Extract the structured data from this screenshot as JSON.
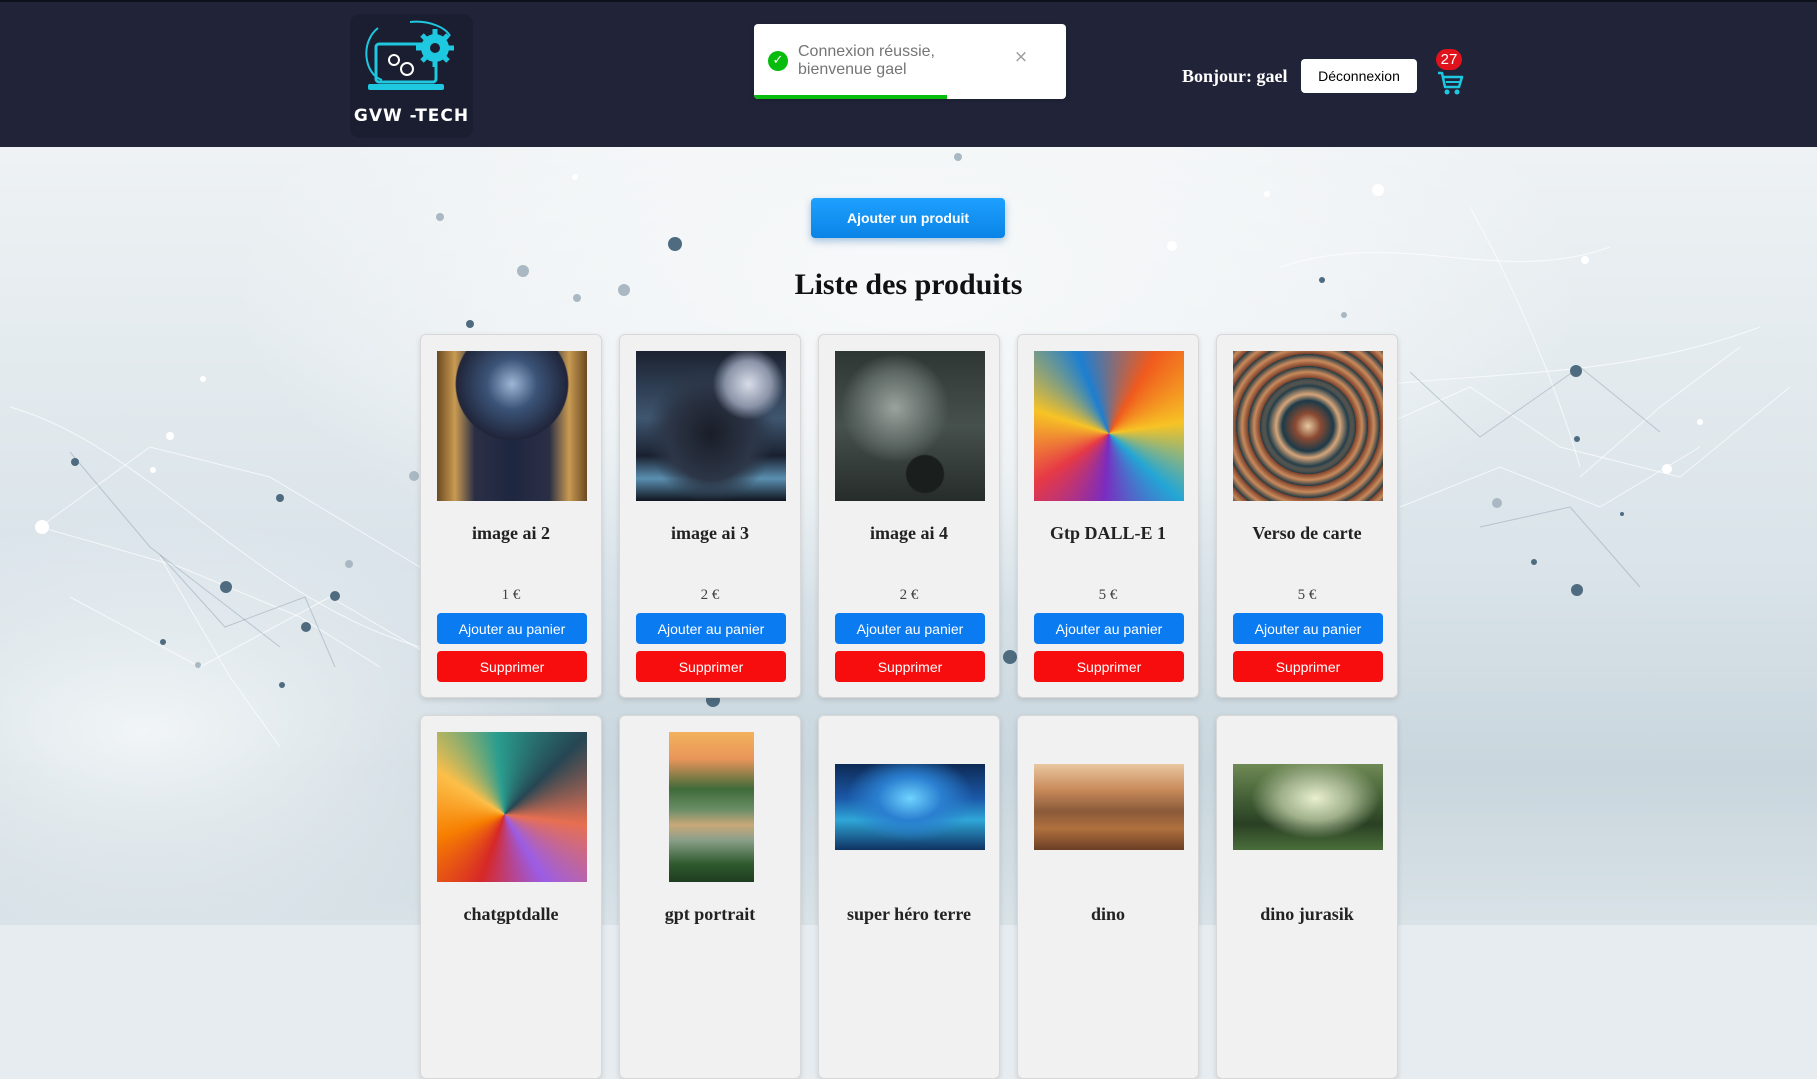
{
  "header": {
    "logo_text": "GVW -TECH",
    "greeting": "Bonjour: gael",
    "logout_label": "Déconnexion",
    "cart_count": "27"
  },
  "toast": {
    "message": "Connexion réussie, bienvenue gael",
    "close": "×",
    "progress_fraction": 0.62
  },
  "main": {
    "add_product_label": "Ajouter un produit",
    "title": "Liste des produits",
    "add_to_cart_label": "Ajouter au panier",
    "delete_label": "Supprimer"
  },
  "products": [
    {
      "name": "image ai 2",
      "price": "1 €",
      "image": "mystical-cathedral"
    },
    {
      "name": "image ai 3",
      "price": "2 €",
      "image": "dark-forest-moon"
    },
    {
      "name": "image ai 4",
      "price": "2 €",
      "image": "moonlit-chapel"
    },
    {
      "name": "Gtp DALL-E 1",
      "price": "5 €",
      "image": "colorful-swirl"
    },
    {
      "name": "Verso de carte",
      "price": "5 €",
      "image": "ornate-pattern"
    },
    {
      "name": "chatgptdalle",
      "price": "",
      "image": "abstract-swirl"
    },
    {
      "name": "gpt portrait",
      "price": "",
      "image": "lake-landscape"
    },
    {
      "name": "super héro terre",
      "price": "",
      "image": "superhero-earth"
    },
    {
      "name": "dino",
      "price": "",
      "image": "desert-canyon"
    },
    {
      "name": "dino jurasik",
      "price": "",
      "image": "jungle-valley"
    }
  ],
  "colors": {
    "header_bg": "#212439",
    "accent_cyan": "#1ec8e0",
    "add_to_cart_bg": "#0b7bf2",
    "delete_bg": "#f70d0d",
    "toast_success": "#07bc0c",
    "badge": "#e0121b"
  }
}
